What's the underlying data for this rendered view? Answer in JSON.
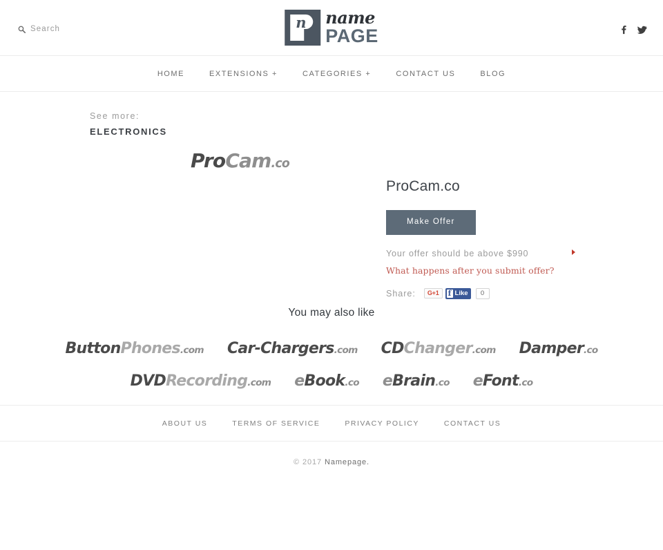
{
  "header": {
    "search": {
      "icon": "search-icon",
      "label": "Search"
    },
    "logo": {
      "mark_letter": "n",
      "name": "name",
      "page": "PAGE"
    },
    "social": [
      {
        "icon": "facebook-icon",
        "name": "Facebook"
      },
      {
        "icon": "twitter-icon",
        "name": "Twitter"
      }
    ]
  },
  "nav": {
    "items": [
      {
        "label": "HOME"
      },
      {
        "label": "EXTENSIONS +"
      },
      {
        "label": "CATEGORIES +"
      },
      {
        "label": "CONTACT US"
      },
      {
        "label": "BLOG"
      }
    ]
  },
  "see_more": {
    "label": "See more:",
    "category": "ELECTRONICS"
  },
  "product": {
    "logo": {
      "part1": "Pro",
      "part2": "Cam",
      "tld": ".co"
    },
    "title": "ProCam.co",
    "make_offer_label": "Make Offer",
    "offer_note": "Your offer should be above $990",
    "offer_min": "$990",
    "offer_link": "What happens after you submit offer?",
    "share_label": "Share:",
    "share": {
      "gplus_label": "G+1",
      "fb_icon": "f",
      "fb_like_label": "Like",
      "fb_count": "0"
    }
  },
  "related": {
    "title": "You may also like",
    "rows": [
      [
        {
          "part1": "Button",
          "part2": "Phones",
          "tld": ".com"
        },
        {
          "part1": "Car-",
          "part2": "Chargers",
          "tld": ".com"
        },
        {
          "part1": "CD",
          "part2": "Changer",
          "tld": ".com"
        },
        {
          "part1": "Damper",
          "part2": "",
          "tld": ".co"
        }
      ],
      [
        {
          "part1": "DVD",
          "part2": "Recording",
          "tld": ".com"
        },
        {
          "part1": "e",
          "part2": "Book",
          "tld": ".co"
        },
        {
          "part1": "e",
          "part2": "Brain",
          "tld": ".co"
        },
        {
          "part1": "e",
          "part2": "Font",
          "tld": ".co"
        }
      ]
    ]
  },
  "footer": {
    "links": [
      {
        "label": "ABOUT US"
      },
      {
        "label": "TERMS OF SERVICE"
      },
      {
        "label": "PRIVACY POLICY"
      },
      {
        "label": "CONTACT US"
      }
    ],
    "copyright_prefix": "© 2017 ",
    "copyright_brand": "Namepage."
  },
  "colors": {
    "accent_button": "#5d6b78",
    "link_red": "#c05a52",
    "arrow_red": "#c0392b",
    "facebook_blue": "#3b5998",
    "gplus_red": "#d34836",
    "logo_dark": "#4c5661"
  }
}
